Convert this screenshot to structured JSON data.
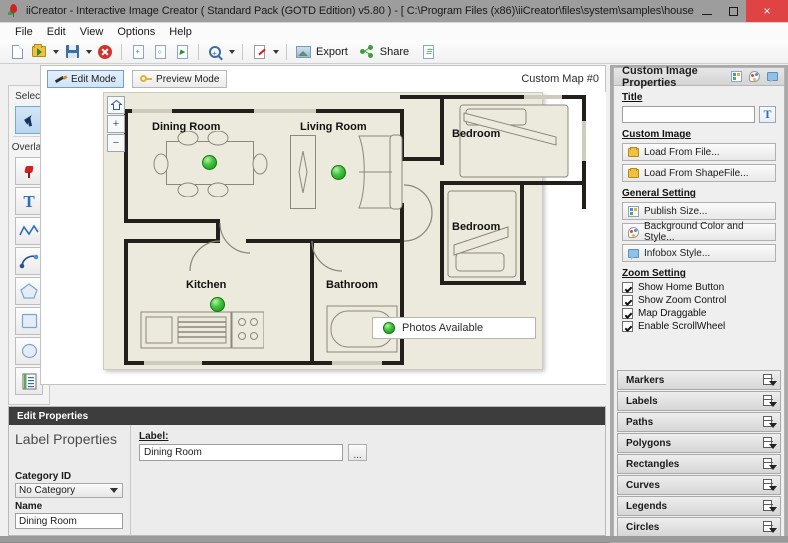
{
  "window": {
    "title": "iiCreator - Interactive Image Creator ( Standard Pack (GOTD Edition) v5.80 ) - [ C:\\Program Files (x86)\\iiCreator\\files\\system\\samples\\house-...",
    "app_icon": "pin-icon",
    "minimize_label": "",
    "maximize_label": "",
    "close_label": "×",
    "close_color": "#e04343"
  },
  "menubar": {
    "items": [
      {
        "label": "File"
      },
      {
        "label": "Edit"
      },
      {
        "label": "View"
      },
      {
        "label": "Options"
      },
      {
        "label": "Help"
      }
    ]
  },
  "toolbar": {
    "buttons": [
      {
        "name": "new-document-button",
        "icon": "document-icon",
        "label": ""
      },
      {
        "name": "open-file-button",
        "icon": "open-folder-icon",
        "label": ""
      },
      {
        "name": "open-file-dropdown",
        "icon": "chevron-down-icon",
        "label": ""
      },
      {
        "name": "save-button",
        "icon": "floppy-disk-icon",
        "label": ""
      },
      {
        "name": "save-dropdown",
        "icon": "chevron-down-icon",
        "label": ""
      },
      {
        "name": "close-button",
        "icon": "stop-circle-icon",
        "label": ""
      },
      {
        "name": "new-page-button",
        "icon": "page-new-icon",
        "label": ""
      },
      {
        "name": "preview-page-button",
        "icon": "page-search-icon",
        "label": ""
      },
      {
        "name": "export-page-button",
        "icon": "page-export-icon",
        "label": ""
      },
      {
        "name": "zoom-button",
        "icon": "magnifier-plus-icon",
        "label": ""
      },
      {
        "name": "zoom-dropdown",
        "icon": "chevron-down-icon",
        "label": ""
      },
      {
        "name": "edit-doc-button",
        "icon": "document-edit-icon",
        "label": ""
      },
      {
        "name": "edit-doc-dropdown",
        "icon": "chevron-down-icon",
        "label": ""
      },
      {
        "name": "export-button",
        "icon": "export-image-icon",
        "label": "Export"
      },
      {
        "name": "share-button",
        "icon": "share-nodes-icon",
        "label": "Share"
      },
      {
        "name": "properties-button",
        "icon": "document-properties-icon",
        "label": ""
      }
    ],
    "export_label": "Export",
    "share_label": "Share"
  },
  "palette": {
    "select_group_label": "Select",
    "overlay_group_label": "Overlay",
    "tools": [
      {
        "name": "tool-select",
        "icon": "cursor-arrow-icon",
        "selected": true
      },
      {
        "name": "tool-marker",
        "icon": "map-pin-icon",
        "selected": false
      },
      {
        "name": "tool-label",
        "icon": "text-T-icon",
        "selected": false
      },
      {
        "name": "tool-path",
        "icon": "polyline-icon",
        "selected": false
      },
      {
        "name": "tool-curve",
        "icon": "curve-icon",
        "selected": false
      },
      {
        "name": "tool-polygon",
        "icon": "pentagon-icon",
        "selected": false
      },
      {
        "name": "tool-rectangle",
        "icon": "square-icon",
        "selected": false
      },
      {
        "name": "tool-circle",
        "icon": "circle-icon",
        "selected": false
      },
      {
        "name": "tool-legend",
        "icon": "legend-list-icon",
        "selected": false
      }
    ]
  },
  "canvas": {
    "edit_mode_label": "Edit Mode",
    "preview_mode_label": "Preview Mode",
    "active_mode": "Edit Mode",
    "map_name": "Custom Map #0",
    "zoom_controls": {
      "home_label": "",
      "zoom_in_label": "+",
      "zoom_out_label": "−"
    },
    "rooms": [
      {
        "name": "dining-room",
        "label": "Dining Room",
        "has_marker": true
      },
      {
        "name": "living-room",
        "label": "Living Room",
        "has_marker": true
      },
      {
        "name": "bedroom-upper",
        "label": "Bedroom",
        "has_marker": false
      },
      {
        "name": "bedroom-lower",
        "label": "Bedroom",
        "has_marker": false
      },
      {
        "name": "kitchen",
        "label": "Kitchen",
        "has_marker": true
      },
      {
        "name": "bathroom",
        "label": "Bathroom",
        "has_marker": false
      }
    ],
    "legend": {
      "entry_label": "Photos Available",
      "marker_color": "#2fbd2f"
    }
  },
  "edit_properties": {
    "header": "Edit Properties",
    "section_title": "Label Properties",
    "category_label": "Category ID",
    "category_value": "No Category",
    "name_label": "Name",
    "name_value": "Dining Room",
    "label_field_label": "Label:",
    "label_field_value": "Dining Room",
    "browse_button_label": "..."
  },
  "dock": {
    "header": "Custom Image Properties",
    "header_icons": [
      {
        "name": "publish-size-icon"
      },
      {
        "name": "background-style-icon"
      },
      {
        "name": "infobox-style-icon"
      }
    ],
    "title_section": {
      "label": "Title",
      "value": "",
      "placeholder": "",
      "font_button_label": "T"
    },
    "custom_image": {
      "label": "Custom Image",
      "buttons": [
        {
          "name": "load-from-file-button",
          "label": "Load From File...",
          "icon": "folder-icon"
        },
        {
          "name": "load-from-shapefile-button",
          "label": "Load From ShapeFile...",
          "icon": "folder-icon"
        }
      ]
    },
    "general_setting": {
      "label": "General Setting",
      "buttons": [
        {
          "name": "publish-size-button",
          "label": "Publish Size...",
          "icon": "publish-size-icon"
        },
        {
          "name": "background-color-style-button",
          "label": "Background Color and Style...",
          "icon": "palette-icon"
        },
        {
          "name": "infobox-style-button",
          "label": "Infobox Style...",
          "icon": "infobox-icon"
        }
      ]
    },
    "zoom_setting": {
      "label": "Zoom Setting",
      "options": [
        {
          "name": "show-home-button-checkbox",
          "label": "Show Home Button",
          "checked": true
        },
        {
          "name": "show-zoom-control-checkbox",
          "label": "Show Zoom Control",
          "checked": true
        },
        {
          "name": "map-draggable-checkbox",
          "label": "Map Draggable",
          "checked": true
        },
        {
          "name": "enable-scrollwheel-checkbox",
          "label": "Enable ScrollWheel",
          "checked": true
        }
      ]
    },
    "accordion": [
      {
        "name": "accordion-markers",
        "label": "Markers"
      },
      {
        "name": "accordion-labels",
        "label": "Labels"
      },
      {
        "name": "accordion-paths",
        "label": "Paths"
      },
      {
        "name": "accordion-polygons",
        "label": "Polygons"
      },
      {
        "name": "accordion-rectangles",
        "label": "Rectangles"
      },
      {
        "name": "accordion-curves",
        "label": "Curves"
      },
      {
        "name": "accordion-legends",
        "label": "Legends"
      },
      {
        "name": "accordion-circles",
        "label": "Circles"
      }
    ]
  }
}
